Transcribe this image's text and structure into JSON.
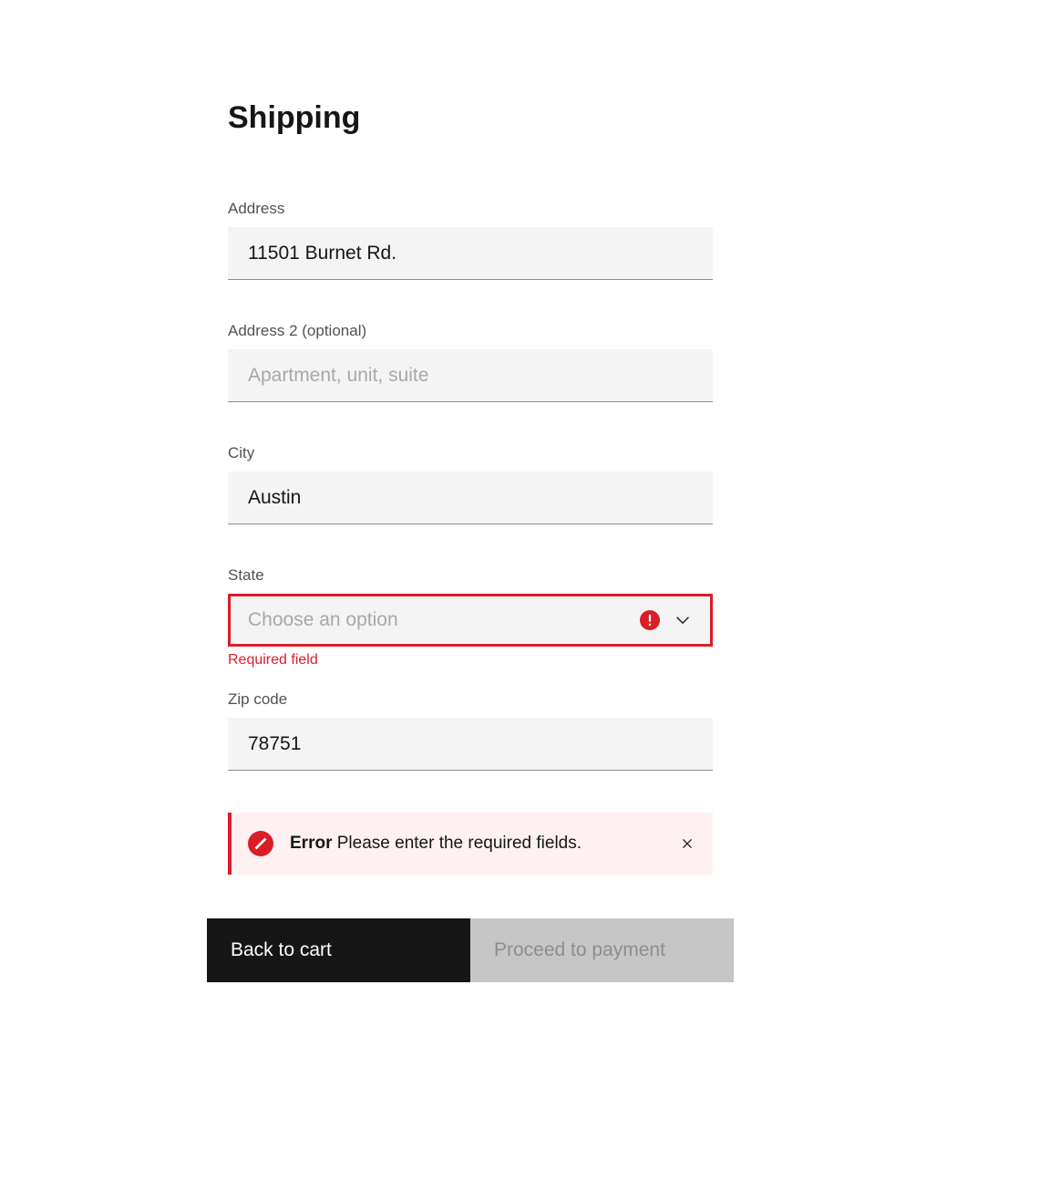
{
  "title": "Shipping",
  "fields": {
    "address": {
      "label": "Address",
      "value": "11501 Burnet Rd."
    },
    "address2": {
      "label": "Address 2 (optional)",
      "placeholder": "Apartment, unit, suite"
    },
    "city": {
      "label": "City",
      "value": "Austin"
    },
    "state": {
      "label": "State",
      "placeholder": "Choose an option",
      "error": "Required field"
    },
    "zip": {
      "label": "Zip code",
      "value": "78751"
    }
  },
  "notification": {
    "title": "Error",
    "message": " Please enter the required fields."
  },
  "buttons": {
    "back": "Back to cart",
    "proceed": "Proceed to payment"
  }
}
